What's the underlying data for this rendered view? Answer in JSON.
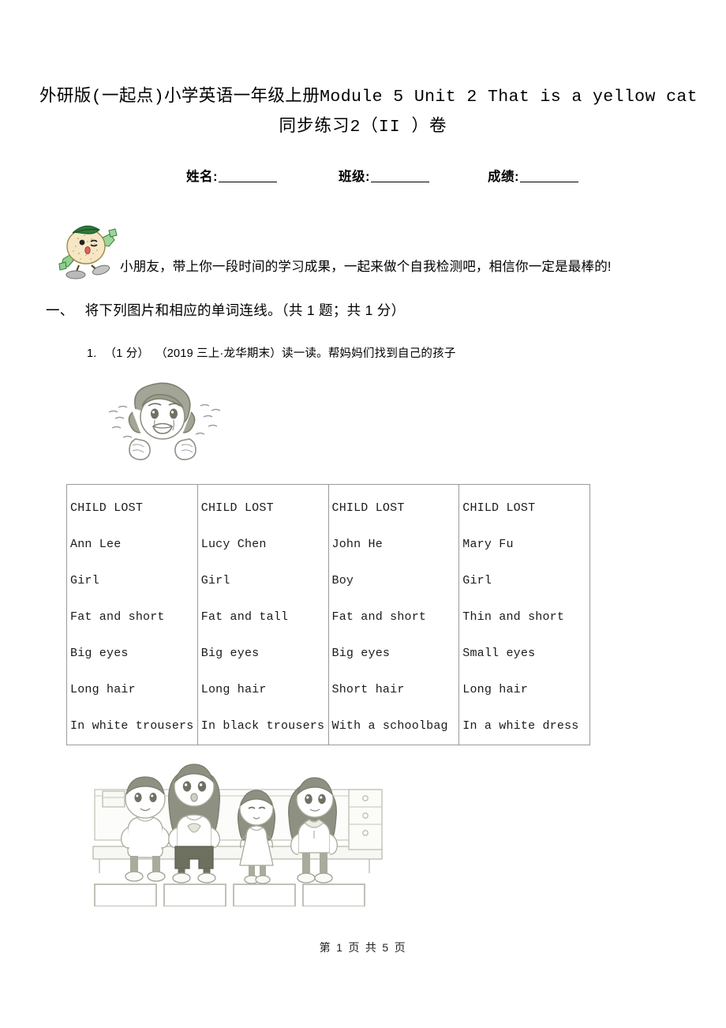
{
  "document": {
    "title_line_1": "外研版(一起点)小学英语一年级上册Module 5 Unit 2 That is a yellow cat",
    "title_line_2": "同步练习2（II ）卷"
  },
  "student_info": {
    "name_label": "姓名:",
    "class_label": "班级:",
    "score_label": "成绩:"
  },
  "mascot": {
    "icon_name": "egg-mascot-icon",
    "encouragement": "小朋友，带上你一段时间的学习成果，一起来做个自我检测吧，相信你一定是最棒的!"
  },
  "section": {
    "number": "一、",
    "heading": "将下列图片和相应的单词连线。（共 1 题；共 1 分）"
  },
  "question": {
    "number": "1.",
    "score": "（1 分）",
    "source": "（2019 三上·龙华期末）",
    "prompt": "读一读。帮妈妈们找到自己的孩子",
    "illustration_woman": "crying-mother-illustration",
    "illustration_children": "children-on-bench-illustration"
  },
  "lost_table": {
    "columns": [
      {
        "header": "CHILD LOST",
        "name": "Ann Lee",
        "gender": "Girl",
        "build": "Fat and short",
        "eyes": "Big eyes",
        "hair": "Long hair",
        "clothes": "In white trousers"
      },
      {
        "header": "CHILD LOST",
        "name": "Lucy Chen",
        "gender": "Girl",
        "build": "Fat and tall",
        "eyes": "Big eyes",
        "hair": "Long hair",
        "clothes": "In black trousers"
      },
      {
        "header": "CHILD LOST",
        "name": "John He",
        "gender": "Boy",
        "build": "Fat and short",
        "eyes": "Big eyes",
        "hair": "Short hair",
        "clothes": "With a schoolbag"
      },
      {
        "header": "CHILD LOST",
        "name": "Mary Fu",
        "gender": "Girl",
        "build": "Thin and short",
        "eyes": "Small eyes",
        "hair": "Long hair",
        "clothes": "In a white dress"
      }
    ]
  },
  "footer": {
    "page_text": "第 1 页 共 5 页"
  },
  "colors": {
    "text": "#000000",
    "table_border": "#9a9a9a",
    "illustration_ink": "#8f9184",
    "mascot_body": "#f3e2c0",
    "mascot_hat": "#2f7a3c"
  }
}
